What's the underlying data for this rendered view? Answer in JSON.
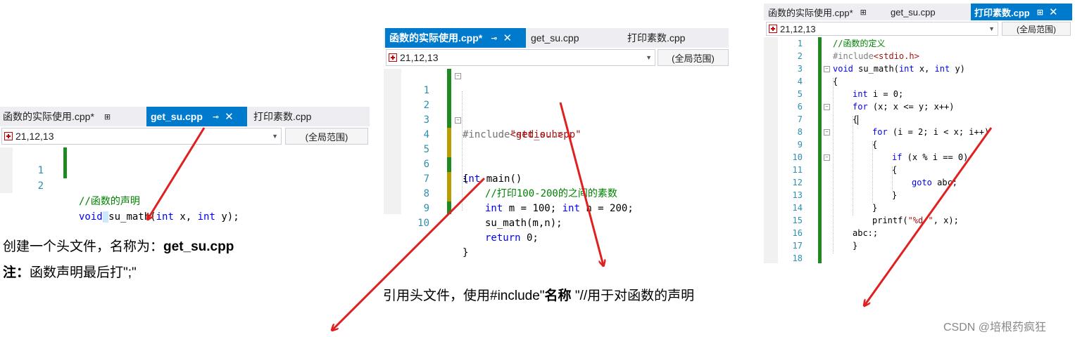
{
  "panel1": {
    "tabs": [
      {
        "label": "函数的实际使用.cpp*",
        "pin": "⊞"
      },
      {
        "label": "get_su.cpp",
        "pin": "⊸",
        "close": "✕"
      },
      {
        "label": "打印素数.cpp"
      }
    ],
    "location": "21,12,13",
    "scope": "(全局范围)",
    "lines": [
      {
        "n": "1",
        "comment": "//函数的声明"
      },
      {
        "n": "2",
        "kw": "void",
        "sel": " ",
        "fn": "su_math(",
        "t1": "int",
        "x": " x, ",
        "t2": "int",
        "y": " y);"
      }
    ]
  },
  "panel2": {
    "tabs": [
      {
        "label": "函数的实际使用.cpp*",
        "pin": "⊸",
        "close": "✕"
      },
      {
        "label": "get_su.cpp"
      },
      {
        "label": "打印素数.cpp"
      }
    ],
    "location": "21,12,13",
    "scope": "(全局范围)",
    "lines": [
      {
        "n": "1",
        "pp": "#include",
        "str": "<stdio.h>"
      },
      {
        "n": "2",
        "pp": "#include",
        "str": "\"get_su.cpp\""
      },
      {
        "n": "3"
      },
      {
        "n": "4",
        "kw": "int",
        "rest": " main()"
      },
      {
        "n": "5",
        "rest": "{"
      },
      {
        "n": "6",
        "comment": "//打印100-200的之间的素数"
      },
      {
        "n": "7",
        "kw": "int",
        "rest": " m = 100; ",
        "kw2": "int",
        "rest2": " n = 200;"
      },
      {
        "n": "8",
        "rest": "su_math(m,n);"
      },
      {
        "n": "9",
        "kw": "return",
        "rest": " 0;"
      },
      {
        "n": "10",
        "rest": "}"
      }
    ]
  },
  "panel3": {
    "tabs": [
      {
        "label": "函数的实际使用.cpp*",
        "pin": "⊞"
      },
      {
        "label": "get_su.cpp"
      },
      {
        "label": "打印素数.cpp",
        "pin": "⊞",
        "close": "✕"
      }
    ],
    "location": "21,12,13",
    "scope": "(全局范围)",
    "lines": [
      {
        "n": "1",
        "comment": "//函数的定义"
      },
      {
        "n": "2",
        "pp": "#include",
        "str": "<stdio.h>"
      },
      {
        "n": "3",
        "kw": "void",
        "rest": " su_math(",
        "kw2": "int",
        "rest2": " x, ",
        "kw3": "int",
        "rest3": " y)"
      },
      {
        "n": "4",
        "rest": "{"
      },
      {
        "n": "5",
        "kw": "int",
        "rest": " i = 0;"
      },
      {
        "n": "6",
        "kw": "for",
        "rest": " (x; x <= y; x++)"
      },
      {
        "n": "7",
        "rest": "{"
      },
      {
        "n": "8",
        "kw": "for",
        "rest": " (i = 2; i < x; i++)"
      },
      {
        "n": "9",
        "rest": "{"
      },
      {
        "n": "10",
        "kw": "if",
        "rest": " (x % i == 0)"
      },
      {
        "n": "11",
        "rest": "{"
      },
      {
        "n": "12",
        "kw": "goto",
        "rest": " abc;"
      },
      {
        "n": "13",
        "rest": "}"
      },
      {
        "n": "14",
        "rest": "}"
      },
      {
        "n": "15",
        "rest": "printf(",
        "str": "\"%d \"",
        "rest2": ", x);"
      },
      {
        "n": "16",
        "rest": "abc:;"
      },
      {
        "n": "17",
        "rest": "}"
      },
      {
        "n": "18"
      }
    ]
  },
  "notes": {
    "note1_line1_prefix": "创建一个头文件，名称为：",
    "note1_line1_bold": "get_su.cpp",
    "note1_line2_bold": "注：",
    "note1_line2_rest": "函数声明最后打\";\"",
    "note2_prefix": "引用头文件，使用#include\"",
    "note2_bold": "名称 ",
    "note2_suffix": "\"//用于对函数的声明"
  },
  "watermark": "CSDN @培根药疯狂",
  "colors": {
    "accent": "#007acc",
    "arrow": "#e02020",
    "keyword": "#0000ff",
    "comment": "#008000",
    "linenumber": "#2b91af"
  }
}
